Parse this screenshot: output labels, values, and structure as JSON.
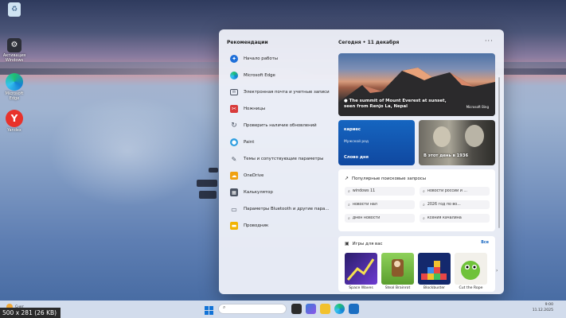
{
  "desktop": {
    "icons": [
      {
        "label": "",
        "icon": "recycle-bin-icon"
      },
      {
        "label": "Активация Windows",
        "icon": "settings-icon"
      },
      {
        "label": "Microsoft Edge",
        "icon": "edge-icon"
      },
      {
        "label": "Yandex",
        "icon": "yandex-icon"
      }
    ]
  },
  "start_panel": {
    "recommendations_title": "Рекомендации",
    "recommendations": [
      {
        "label": "Начало работы",
        "icon": "get-started-icon",
        "color": "#1e6fd9"
      },
      {
        "label": "Microsoft Edge",
        "icon": "edge-icon",
        "color": "#0c8a9c"
      },
      {
        "label": "Электронная почта и учетные записи",
        "icon": "mail-icon",
        "color": "#5b6270"
      },
      {
        "label": "Ножницы",
        "icon": "scissors-icon",
        "color": "#d83b3b"
      },
      {
        "label": "Проверить наличие обновлений",
        "icon": "update-icon",
        "color": "#4a5261"
      },
      {
        "label": "Paint",
        "icon": "paint-icon",
        "color": "#2f9ee0"
      },
      {
        "label": "Темы и сопутствующие параметры",
        "icon": "paintbrush-icon",
        "color": "#5b6270"
      },
      {
        "label": "OneDrive",
        "icon": "onedrive-icon",
        "color": "#f0a10f"
      },
      {
        "label": "Калькулятор",
        "icon": "calculator-icon",
        "color": "#4a5261"
      },
      {
        "label": "Параметры Bluetooth и другие пара...",
        "icon": "bluetooth-icon",
        "color": "#5b6270"
      },
      {
        "label": "Проводник",
        "icon": "folder-icon",
        "color": "#f2b400"
      }
    ],
    "date_header": "Сегодня • 11 декабря",
    "more": "···",
    "main_card": {
      "text": "The summit of Mount Everest at sunset, seen from Renjo La, Nepal",
      "badge": "Microsoft Bing"
    },
    "blue_card": {
      "title": "кариес",
      "subtitle": "Мужской род",
      "footer": "Слово дня"
    },
    "photo_card": {
      "caption": "В этот день в 1936"
    },
    "search_card": {
      "title": "Популярные поисковые запросы",
      "chips": [
        "windows 11",
        "новости россии и ...",
        "новости нал",
        "2026 год по во...",
        "днен новости",
        "ксения качалина"
      ]
    },
    "games_card": {
      "title": "Игры для вас",
      "all_label": "Все",
      "games": [
        {
          "name": "Space Waves",
          "color": "#5b2ea6"
        },
        {
          "name": "Steal Brainrot",
          "color": "#7cc248"
        },
        {
          "name": "Blockbuster",
          "color": "#1b3e9a"
        },
        {
          "name": "Cut the Rope",
          "color": "#f2f0ea"
        }
      ]
    }
  },
  "taskbar": {
    "weather": "Снег",
    "search_placeholder": "",
    "time": "9:00",
    "date": "11.12.2025"
  },
  "caption": "500 x 281 (26 KB)"
}
